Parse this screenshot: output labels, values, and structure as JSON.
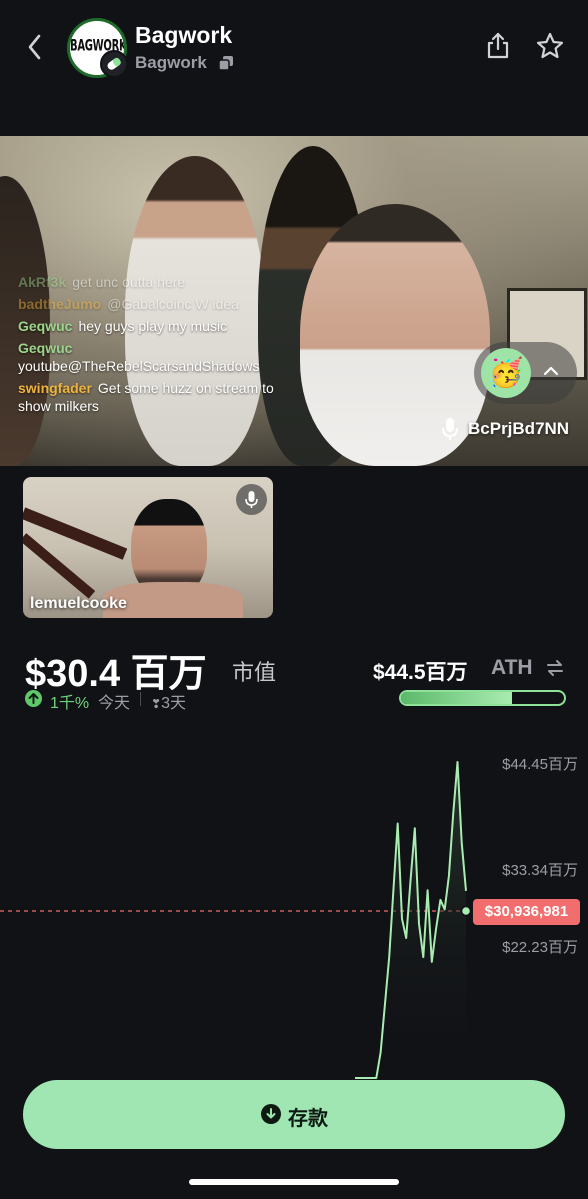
{
  "header": {
    "back_icon": "chevron-left-icon",
    "logo_text": "BAGWORK",
    "title": "Bagwork",
    "subtitle": "Bagwork",
    "copy_icon": "copy-icon",
    "share_icon": "share-icon",
    "star_icon": "star-icon"
  },
  "stream": {
    "chat": [
      {
        "user": "AkRf3k",
        "message": "get unc outta here",
        "faded": true,
        "color": "green"
      },
      {
        "user": "badtheJumo",
        "message": "@Gabalcoinc W idea",
        "faded": true,
        "color": "orange"
      },
      {
        "user": "Geqwuc",
        "message": "hey guys play my music",
        "faded": false,
        "color": "green"
      },
      {
        "user": "Geqwuc",
        "message": "youtube@TheRebelScarsandShadows",
        "faded": false,
        "color": "green",
        "block": true
      },
      {
        "user": "swingfader",
        "message": "Get some huzz on stream to show milkers",
        "faded": false,
        "color": "orange"
      }
    ],
    "reaction_emoji": "🥳",
    "host_name": "BcPrjBd7NN",
    "host_mic_icon": "microphone-icon",
    "expand_icon": "chevron-up-icon"
  },
  "guest": {
    "name": "lemuelcooke",
    "mic_icon": "microphone-icon"
  },
  "stats": {
    "market_cap": "$30.4 百万",
    "market_cap_label": "市值",
    "change_value": "1千%",
    "change_period": "今天",
    "period_selector": "3天",
    "ath_value": "$44.5百万",
    "ath_label": "ATH",
    "ath_progress": 0.68
  },
  "chart_data": {
    "type": "line",
    "y_ticks": [
      "$44.45百万",
      "$33.34百万",
      "$22.23百万"
    ],
    "current_price_label": "$30,936,981",
    "current_price": 30936981,
    "series": [
      {
        "values": [
          1.0,
          1.3,
          2.5,
          4.0,
          6.5,
          10.0,
          14.0,
          19.0,
          24.0,
          31.0,
          38.0,
          28.0,
          26.0,
          32.0,
          37.5,
          27.5,
          24.0,
          31.0,
          23.5,
          27.0,
          30.0,
          29.0,
          32.5,
          39.0,
          44.45,
          36.0,
          30.94
        ]
      }
    ],
    "colors": {
      "line": "#a9ecb1",
      "price_line": "#f26d6d"
    }
  },
  "deposit": {
    "label": "存款",
    "icon": "download-icon"
  }
}
